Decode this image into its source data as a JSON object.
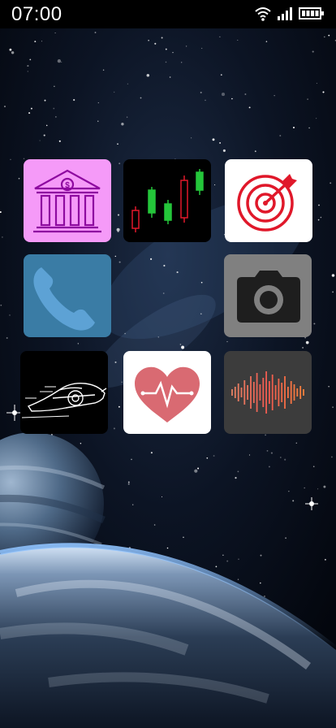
{
  "status_bar": {
    "time": "07:00",
    "icons": [
      "wifi-icon",
      "signal-icon",
      "battery-icon"
    ]
  },
  "home_screen": {
    "wallpaper": "space-planet-wallpaper",
    "apps": [
      {
        "icon": "bank-icon",
        "color": "#f59af8"
      },
      {
        "icon": "candlestick-chart-icon",
        "color": "#000000"
      },
      {
        "icon": "target-icon",
        "color": "#ffffff"
      },
      {
        "icon": "phone-icon",
        "color": "#3a7ca5"
      },
      {
        "icon": "camera-icon",
        "color": "#808080"
      },
      {
        "icon": "sports-car-icon",
        "color": "#000000"
      },
      {
        "icon": "heart-rate-icon",
        "color": "#ffffff"
      },
      {
        "icon": "sound-wave-icon",
        "color": "#3c3c3c"
      }
    ]
  }
}
